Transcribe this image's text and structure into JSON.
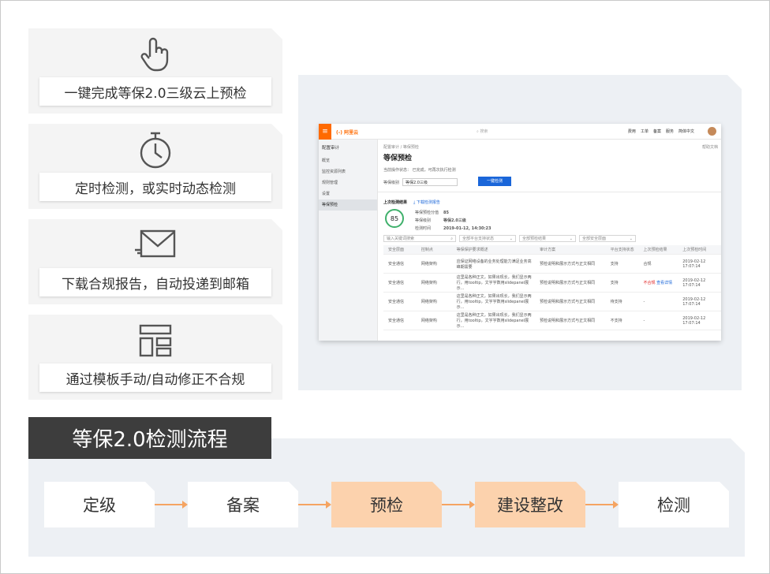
{
  "features": [
    {
      "icon": "touch-hand-icon",
      "label": "一键完成等保2.0三级云上预检"
    },
    {
      "icon": "stopwatch-icon",
      "label": "定时检测，或实时动态检测"
    },
    {
      "icon": "mail-send-icon",
      "label": "下载合规报告，自动投递到邮箱"
    },
    {
      "icon": "template-layout-icon",
      "label": "通过模板手动/自动修正不合规"
    }
  ],
  "console": {
    "logo": "(-) 阿里云",
    "search_placeholder": "搜索",
    "nav": [
      "费用",
      "工单",
      "备案",
      "服务",
      "简体中文"
    ],
    "sidebar_title": "配置审计",
    "sidebar_items": [
      "概览",
      "监控资源列表",
      "规则管理",
      "设置",
      "等保预检"
    ],
    "breadcrumb": "配置审计 / 等保预检",
    "help": "帮助文档",
    "title": "等保预检",
    "desc": "当前操作状态：  已完成，可再次执行检测",
    "level_label": "等保级别",
    "level_value": "等保2.0三级",
    "run_button": "一键检测",
    "last_result_title": "上次检测结果",
    "download_link": "下载检测报告",
    "score": "85",
    "meta": [
      {
        "k": "等保预检分值",
        "v": "85"
      },
      {
        "k": "等保级别",
        "v": "等保2.0三级"
      },
      {
        "k": "检测时间",
        "v": "2019-01-12, 14:30:23"
      }
    ],
    "filters": [
      "输入关键词搜索",
      "全部平台支持状态",
      "全部预检结果",
      "全部安全层面"
    ],
    "table_headers": [
      "安全层面",
      "控制点",
      "等保保护要求概述",
      "审计方案",
      "平台支持状态",
      "上次预检结果",
      "上次预检时间"
    ],
    "rows": [
      {
        "c1": "安全通信",
        "c2": "网络架构",
        "c3": "应保证网络设备的业务处理能力满足业务高峰期需要",
        "c4": "预检说明和展示方式与正文相同",
        "c5": "支持",
        "c6": "合规",
        "c6b": "",
        "c7": "2019-02-12 17:07:14"
      },
      {
        "c1": "安全通信",
        "c2": "网络架构",
        "c3": "这里是各种正文，如果出现长，我们显示两行，用tooltip，文字字数用slidepanel展示...",
        "c4": "预检说明和展示方式与正文相同",
        "c5": "支持",
        "c6": "不合规",
        "c6b": "查看详情",
        "c7": "2019-02-12 17:07:14"
      },
      {
        "c1": "安全通信",
        "c2": "网络架构",
        "c3": "这里是各种正文，如果出现长，我们显示两行，用tooltip，文字字数用slidepanel展示...",
        "c4": "预检说明和展示方式与正文相同",
        "c5": "待支持",
        "c6": "-",
        "c6b": "",
        "c7": "2019-02-12 17:07:14"
      },
      {
        "c1": "安全通信",
        "c2": "网络架构",
        "c3": "这里是各种正文，如果出现长，我们显示两行，用tooltip，文字字数用slidepanel展示...",
        "c4": "预检说明和展示方式与正文相同",
        "c5": "不支持",
        "c6": "-",
        "c6b": "",
        "c7": "2019-02-12 17:07:14"
      }
    ]
  },
  "process": {
    "title": "等保2.0检测流程",
    "steps": [
      "定级",
      "备案",
      "预检",
      "建设整改",
      "检测"
    ]
  }
}
